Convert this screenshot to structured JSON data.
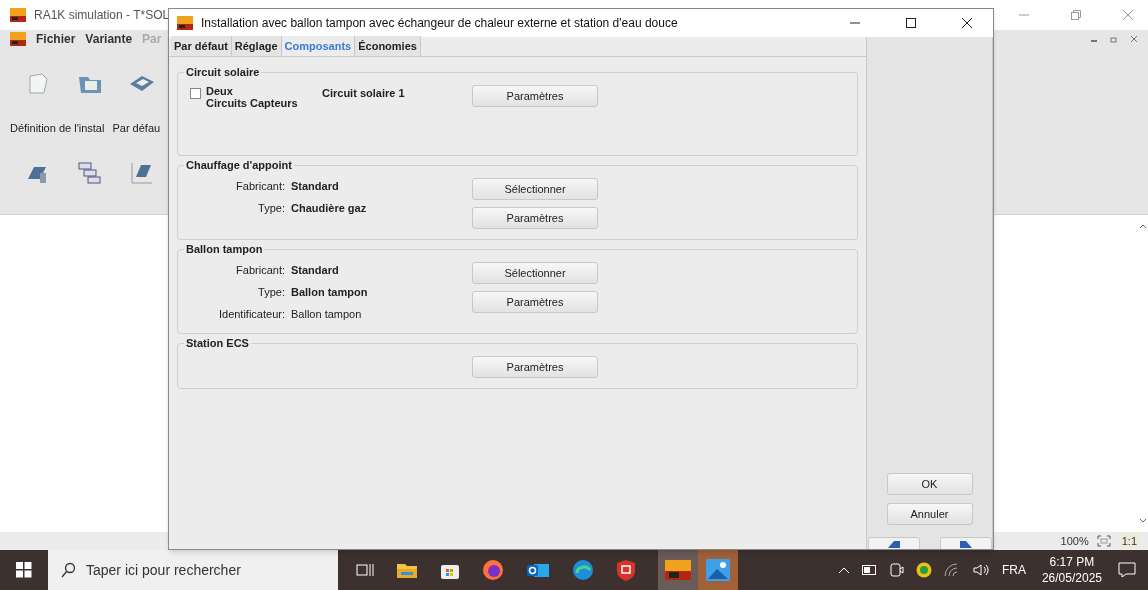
{
  "app": {
    "title": "RA1K simulation - T*SOL",
    "menu": [
      {
        "label": "Fichier",
        "disabled": false
      },
      {
        "label": "Variante",
        "disabled": false
      },
      {
        "label": "Par",
        "disabled": true
      }
    ],
    "toolbar_labels": [
      "Définition de l'instal",
      "Par défau"
    ],
    "status": {
      "zoom": "100%",
      "ratio": "1:1"
    }
  },
  "dialog": {
    "title": "Installation avec ballon tampon avec échangeur de chaleur externe et station d'eau douce",
    "tabs": [
      {
        "label": "Par défaut",
        "selected": false
      },
      {
        "label": "Réglage",
        "selected": false
      },
      {
        "label": "Composants",
        "selected": true
      },
      {
        "label": "Économies",
        "selected": false
      }
    ],
    "groups": [
      {
        "title": "Circuit solaire",
        "checkbox": {
          "label_lines": [
            "Deux",
            "Circuits Capteurs"
          ],
          "checked": false
        },
        "name": "Circuit solaire 1",
        "buttons": [
          "Paramètres"
        ]
      },
      {
        "title": "Chauffage d'appoint",
        "fields": [
          {
            "label": "Fabricant:",
            "value": "Standard",
            "kind": "choice"
          },
          {
            "label": "Type:",
            "value": "Chaudière gaz",
            "kind": "choice"
          }
        ],
        "buttons": [
          "Sélectionner",
          "Paramètres"
        ]
      },
      {
        "title": "Ballon tampon",
        "fields": [
          {
            "label": "Fabricant:",
            "value": "Standard",
            "kind": "choice"
          },
          {
            "label": "Type:",
            "value": "Ballon tampon",
            "kind": "choice"
          },
          {
            "label": "Identificateur:",
            "value": "Ballon tampon",
            "kind": "plain"
          }
        ],
        "buttons": [
          "Sélectionner",
          "Paramètres"
        ]
      },
      {
        "title": "Station ECS",
        "buttons": [
          "Paramètres"
        ]
      }
    ],
    "actions": [
      "OK",
      "Annuler"
    ]
  },
  "taskbar": {
    "search_placeholder": "Taper ici pour rechercher",
    "language": "FRA",
    "time": "6:17 PM",
    "date": "26/05/2025"
  }
}
